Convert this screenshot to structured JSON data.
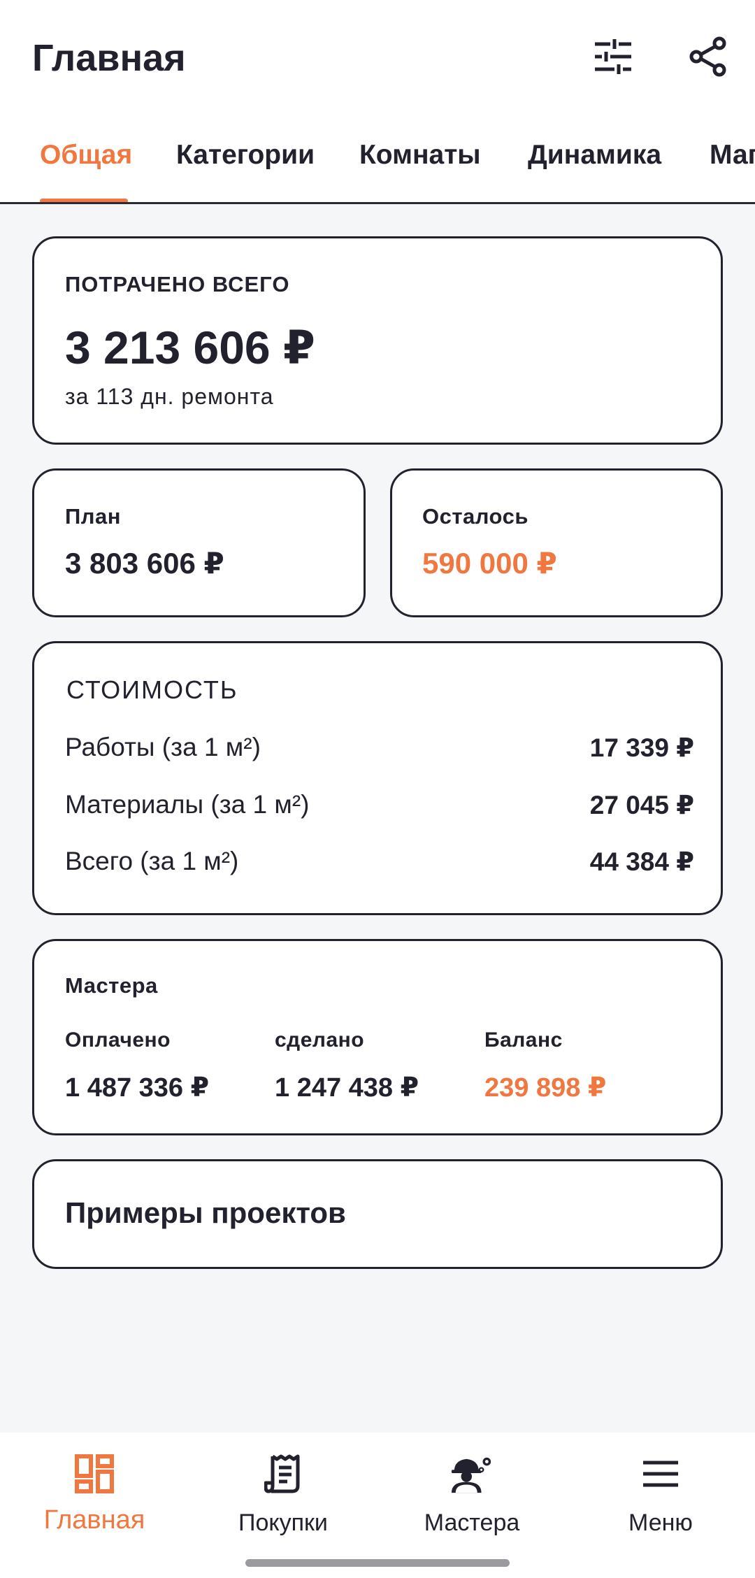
{
  "header": {
    "title": "Главная",
    "filter_icon": "sliders-icon",
    "share_icon": "share-icon"
  },
  "tabs": [
    {
      "label": "Общая",
      "active": true
    },
    {
      "label": "Категории",
      "active": false
    },
    {
      "label": "Комнаты",
      "active": false
    },
    {
      "label": "Динамика",
      "active": false
    },
    {
      "label": "Маг",
      "active": false
    }
  ],
  "total": {
    "caption": "ПОТРАЧЕНО ВСЕГО",
    "amount": "3 213 606 ₽",
    "subtitle": "за 113 дн. ремонта"
  },
  "plan": {
    "label": "План",
    "amount": "3 803 606 ₽"
  },
  "remaining": {
    "label": "Осталось",
    "amount": "590 000 ₽"
  },
  "cost": {
    "caption": "СТОИМОСТЬ",
    "rows": [
      {
        "label": "Работы (за 1 м²)",
        "value": "17 339 ₽"
      },
      {
        "label": "Материалы (за 1 м²)",
        "value": "27 045 ₽"
      },
      {
        "label": "Всего (за 1 м²)",
        "value": "44 384 ₽"
      }
    ]
  },
  "masters": {
    "title": "Мастера",
    "paid_label": "Оплачено",
    "paid_value": "1 487 336 ₽",
    "done_label": "сделано",
    "done_value": "1 247 438 ₽",
    "balance_label": "Баланс",
    "balance_value": "239 898 ₽"
  },
  "examples": {
    "title": "Примеры проектов"
  },
  "bottom_nav": [
    {
      "label": "Главная",
      "icon": "dashboard-icon",
      "active": true
    },
    {
      "label": "Покупки",
      "icon": "receipt-icon",
      "active": false
    },
    {
      "label": "Мастера",
      "icon": "worker-icon",
      "active": false
    },
    {
      "label": "Меню",
      "icon": "menu-icon",
      "active": false
    }
  ],
  "colors": {
    "accent": "#f07840",
    "text": "#22222e",
    "background": "#f5f6f8"
  }
}
